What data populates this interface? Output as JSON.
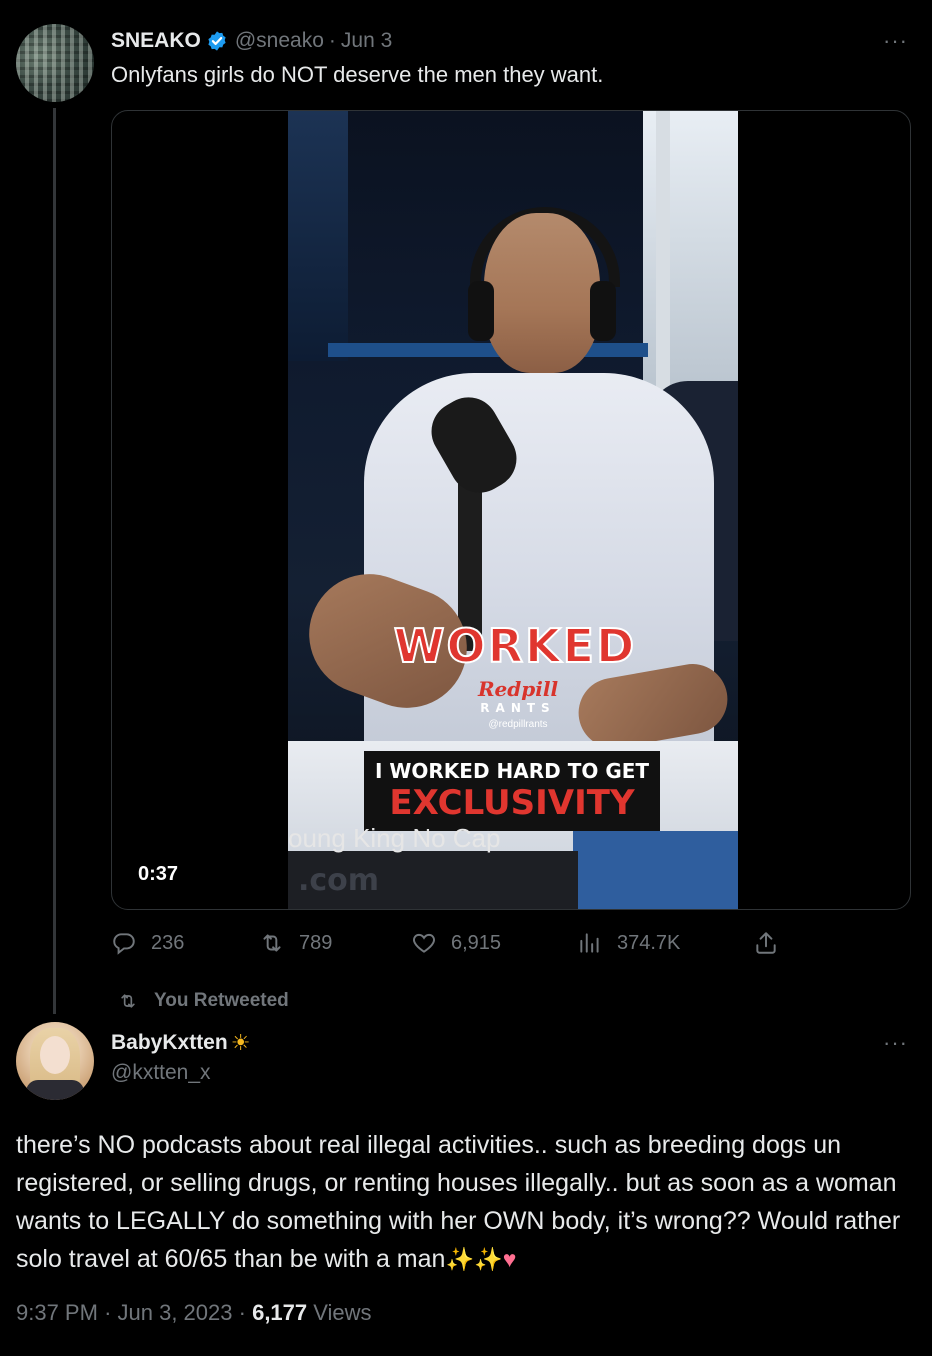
{
  "quoted_tweet": {
    "display_name": "SNEAKO",
    "handle": "@sneako",
    "separator": "·",
    "date": "Jun 3",
    "text": "Onlyfans girls do NOT deserve the men they want.",
    "more": "···",
    "video": {
      "duration": "0:37",
      "caption_big": "WORKED",
      "logo_line1": "Redpill",
      "logo_line2": "RANTS",
      "logo_line3": "@redpillrants",
      "caption_line1": "I WORKED HARD TO GET",
      "caption_line2": "EXCLUSIVITY",
      "watermark": "oung King No Cap",
      "bottom_text": ".com"
    },
    "actions": {
      "replies": "236",
      "retweets": "789",
      "likes": "6,915",
      "views": "374.7K"
    }
  },
  "retweet_label": "You Retweeted",
  "main_tweet": {
    "display_name": "BabyKxtten",
    "handle": "@kxtten_x",
    "more": "···",
    "text": "there’s NO podcasts about real illegal activities.. such as breeding dogs un registered, or selling drugs, or renting houses illegally.. but as soon as a woman wants to LEGALLY do something with her OWN body, it’s wrong?? Would rather solo travel at 60/65 than be with a man",
    "time": "9:37 PM",
    "separator": "·",
    "date": "Jun 3, 2023",
    "views_count": "6,177",
    "views_label": "Views"
  },
  "colors": {
    "background": "#000000",
    "text_primary": "#e7e9ea",
    "text_secondary": "#71767b",
    "verified_blue": "#1d9bf0",
    "caption_red": "#e0362f"
  },
  "icons": [
    "verified-badge-icon",
    "more-icon",
    "reply-icon",
    "retweet-icon",
    "like-icon",
    "views-icon",
    "share-icon",
    "sun-emoji-icon",
    "sparkles-emoji-icon",
    "heart-emoji-icon"
  ]
}
